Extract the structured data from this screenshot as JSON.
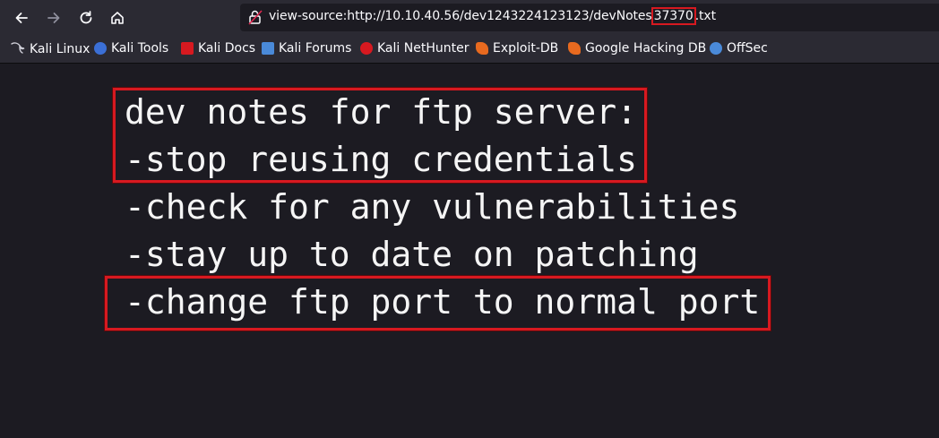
{
  "browser": {
    "nav": {
      "back_icon": "back-arrow-icon",
      "forward_icon": "forward-arrow-icon",
      "reload_icon": "reload-icon",
      "home_icon": "home-icon"
    },
    "url": {
      "prefix": "view-source:http://10.10.40.56/dev1243224123123/devNotes",
      "highlighted": "37370",
      "suffix": ".txt"
    },
    "bookmarks": [
      {
        "label": "Kali Linux",
        "icon": "kali-dragon-icon",
        "color": "#cfcfd8"
      },
      {
        "label": "Kali Tools",
        "icon": "kali-tools-icon",
        "color": "#3b6fd6"
      },
      {
        "label": "Kali Docs",
        "icon": "kali-docs-icon",
        "color": "#d71920"
      },
      {
        "label": "Kali Forums",
        "icon": "kali-forums-icon",
        "color": "#4a8ad9"
      },
      {
        "label": "Kali NetHunter",
        "icon": "nethunter-icon",
        "color": "#d71920"
      },
      {
        "label": "Exploit-DB",
        "icon": "exploit-db-icon",
        "color": "#e86a1f"
      },
      {
        "label": "Google Hacking DB",
        "icon": "ghdb-icon",
        "color": "#e86a1f"
      },
      {
        "label": "OffSec",
        "icon": "offsec-icon",
        "color": "#4a8ad9"
      }
    ]
  },
  "page": {
    "lines": [
      "dev notes for ftp server:",
      "-stop reusing credentials",
      "-check for any vulnerabilities",
      "-stay up to date on patching",
      "-change ftp port to normal port"
    ]
  },
  "colors": {
    "highlight": "#d71920",
    "background": "#1c1b22",
    "toolbar": "#2b2a33"
  }
}
